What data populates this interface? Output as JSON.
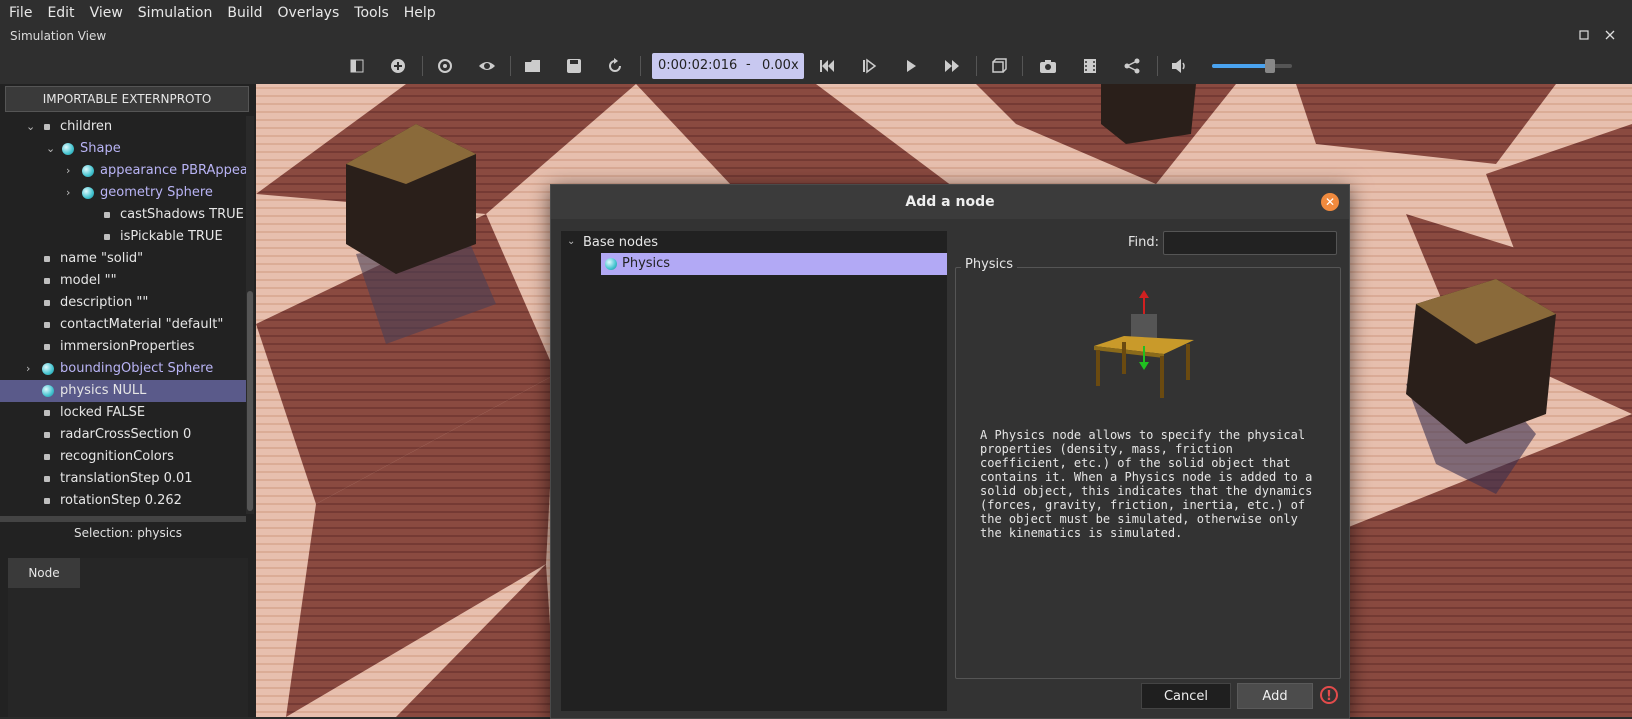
{
  "menu": [
    "File",
    "Edit",
    "View",
    "Simulation",
    "Build",
    "Overlays",
    "Tools",
    "Help"
  ],
  "window": {
    "title": "Simulation View"
  },
  "toolbar": {
    "time": "0:00:02:016",
    "time_sep": "-",
    "speed": "0.00x",
    "volume": 0.72
  },
  "left_panel": {
    "externproto_button": "IMPORTABLE EXTERNPROTO",
    "tree": [
      {
        "label": "children",
        "indent": 0,
        "kind": "field",
        "arrow": "v"
      },
      {
        "label": "Shape",
        "indent": 1,
        "kind": "node",
        "arrow": "v"
      },
      {
        "label": "appearance PBRAppearance",
        "indent": 2,
        "kind": "node",
        "arrow": ">"
      },
      {
        "label": "geometry Sphere",
        "indent": 2,
        "kind": "node",
        "arrow": ">"
      },
      {
        "label": "castShadows TRUE",
        "indent": 3,
        "kind": "field",
        "arrow": ""
      },
      {
        "label": "isPickable TRUE",
        "indent": 3,
        "kind": "field",
        "arrow": ""
      },
      {
        "label": "name \"solid\"",
        "indent": 0,
        "kind": "field",
        "arrow": ""
      },
      {
        "label": "model \"\"",
        "indent": 0,
        "kind": "field",
        "arrow": ""
      },
      {
        "label": "description \"\"",
        "indent": 0,
        "kind": "field",
        "arrow": ""
      },
      {
        "label": "contactMaterial \"default\"",
        "indent": 0,
        "kind": "field",
        "arrow": ""
      },
      {
        "label": "immersionProperties",
        "indent": 0,
        "kind": "field",
        "arrow": ""
      },
      {
        "label": "boundingObject Sphere",
        "indent": 0,
        "kind": "node",
        "arrow": ">"
      },
      {
        "label": "physics NULL",
        "indent": 0,
        "kind": "selected",
        "arrow": ""
      },
      {
        "label": "locked FALSE",
        "indent": 0,
        "kind": "field",
        "arrow": ""
      },
      {
        "label": "radarCrossSection 0",
        "indent": 0,
        "kind": "field",
        "arrow": ""
      },
      {
        "label": "recognitionColors",
        "indent": 0,
        "kind": "field",
        "arrow": ""
      },
      {
        "label": "translationStep 0.01",
        "indent": 0,
        "kind": "field",
        "arrow": ""
      },
      {
        "label": "rotationStep 0.262",
        "indent": 0,
        "kind": "field",
        "arrow": ""
      }
    ],
    "selection": "Selection: physics",
    "tab": "Node"
  },
  "dialog": {
    "title": "Add a node",
    "tree_root": "Base nodes",
    "tree_item": "Physics",
    "find_label": "Find:",
    "find_value": "",
    "group_title": "Physics",
    "description": "A Physics node allows to specify the physical\nproperties (density, mass, friction\ncoefficient, etc.) of the solid object that\ncontains it. When a Physics node is added to a\nsolid object, this indicates that the dynamics\n(forces, gravity, friction, inertia, etc.) of\nthe object must be simulated, otherwise only\nthe kinematics is simulated.",
    "cancel": "Cancel",
    "add": "Add",
    "warning_glyph": "!"
  },
  "colors": {
    "accent": "#b2a9f5",
    "selection": "#5a5a8a",
    "close": "#f08a3e",
    "warn": "#e24b4b"
  }
}
